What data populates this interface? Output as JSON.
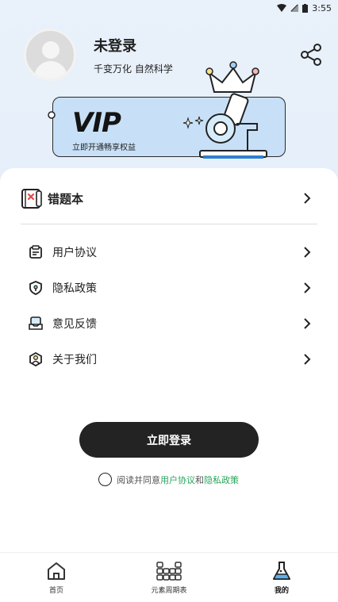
{
  "status_bar": {
    "time": "3:55",
    "icons": [
      "wifi-icon",
      "signal-icon",
      "battery-icon"
    ]
  },
  "profile": {
    "name": "未登录",
    "slogan": "千变万化 自然科学"
  },
  "vip": {
    "title": "VIP",
    "subtitle": "立即开通畅享权益"
  },
  "menu": {
    "mistakes": {
      "label": "错题本",
      "icon": "mistake-book-icon"
    },
    "items": [
      {
        "label": "用户协议",
        "icon": "document-icon"
      },
      {
        "label": "隐私政策",
        "icon": "shield-icon"
      },
      {
        "label": "意见反馈",
        "icon": "feedback-icon"
      },
      {
        "label": "关于我们",
        "icon": "about-icon"
      }
    ]
  },
  "login": {
    "button_label": "立即登录",
    "agree_prefix": "阅读并同意",
    "user_agreement": "用户协议",
    "and": "和",
    "privacy_policy": "隐私政策"
  },
  "tabs": [
    {
      "label": "首页",
      "icon": "home-icon"
    },
    {
      "label": "元素周期表",
      "icon": "periodic-table-icon"
    },
    {
      "label": "我的",
      "icon": "flask-icon",
      "active": true
    }
  ],
  "colors": {
    "accent_link": "#26a65b",
    "button_bg": "#232323",
    "vip_card": "#c7e0f7",
    "header_bg": "#e9f1fb"
  }
}
